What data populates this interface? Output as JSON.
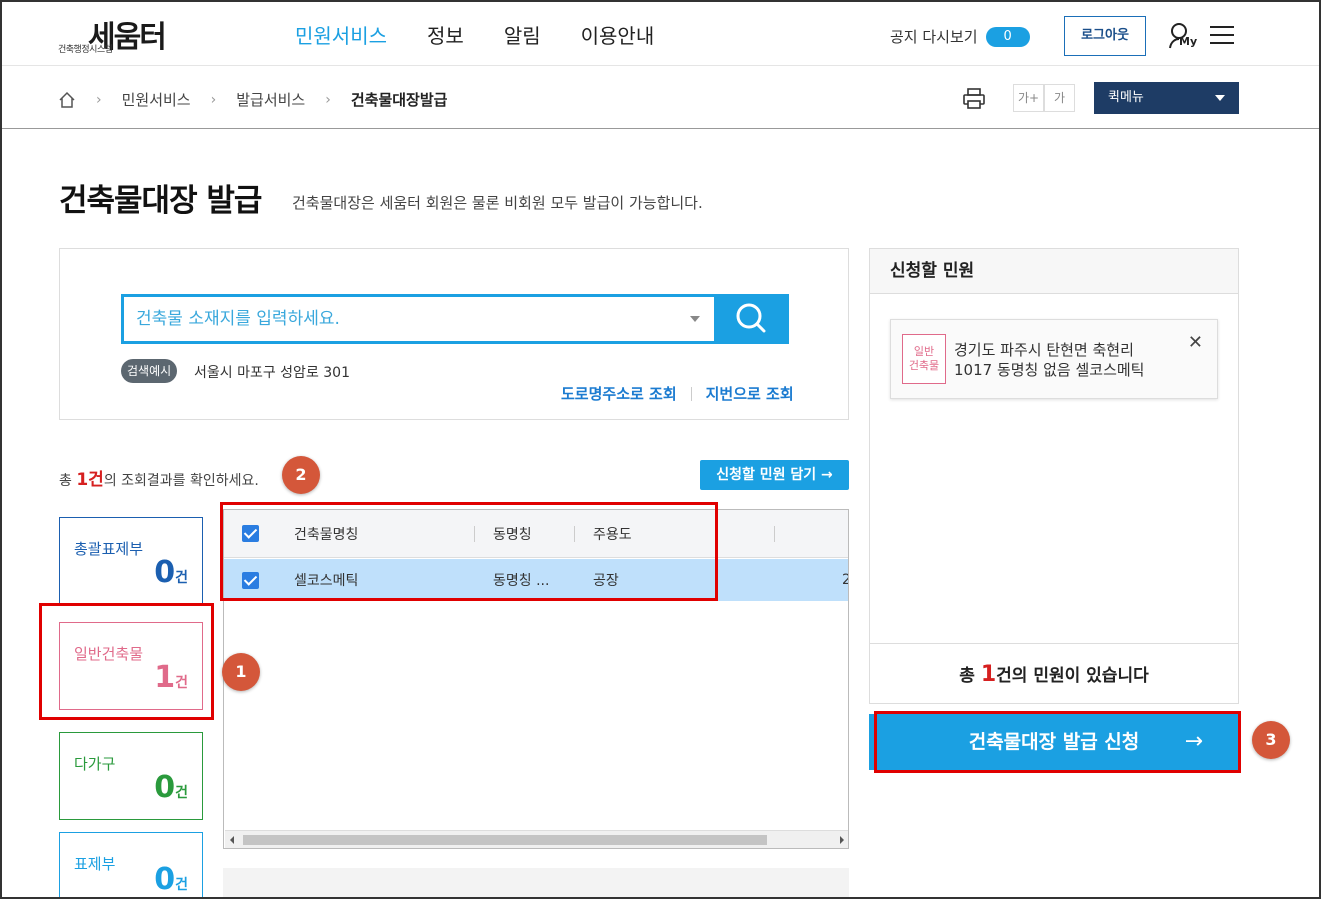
{
  "header": {
    "logo_text": "세움터",
    "logo_sub": "건축행정시스템",
    "nav": [
      "민원서비스",
      "정보",
      "알림",
      "이용안내"
    ],
    "notice_label": "공지 다시보기",
    "notice_count": "0",
    "logout_label": "로그아웃",
    "my_label": "My"
  },
  "breadcrumb": {
    "items": [
      "민원서비스",
      "발급서비스",
      "건축물대장발급"
    ]
  },
  "toolbar": {
    "font_increase": "가+",
    "font_normal": "가",
    "quick_menu": "퀵메뉴"
  },
  "page": {
    "title": "건축물대장 발급",
    "description": "건축물대장은 세움터 회원은 물론 비회원 모두 발급이 가능합니다."
  },
  "search": {
    "placeholder": "건축물 소재지를 입력하세요.",
    "example_badge": "검색예시",
    "example_text": "서울시 마포구 성암로 301",
    "link_road": "도로명주소로 조회",
    "link_lot": "지번으로 조회"
  },
  "results": {
    "prefix": "총 ",
    "count": "1건",
    "suffix": "의 조회결과를 확인하세요.",
    "add_button": "신청할 민원 담기 →"
  },
  "categories": [
    {
      "label": "총괄표제부",
      "count": "0",
      "unit": "건"
    },
    {
      "label": "일반건축물",
      "count": "1",
      "unit": "건"
    },
    {
      "label": "다가구",
      "count": "0",
      "unit": "건"
    },
    {
      "label": "표제부",
      "count": "0",
      "unit": "건"
    }
  ],
  "table": {
    "headers": [
      "건축물명칭",
      "동명칭",
      "주용도"
    ],
    "rows": [
      {
        "name": "셀코스메틱",
        "dong": "동명칭 ...",
        "use": "공장",
        "extra": "2"
      }
    ]
  },
  "cart": {
    "title": "신청할 민원",
    "tag_line1": "일반",
    "tag_line2": "건축물",
    "address_line1": "경기도 파주시 탄현면 축현리",
    "address_line2": "1017 동명칭 없음 셀코스메틱",
    "close": "✕",
    "summary_prefix": "총 ",
    "summary_count": "1",
    "summary_suffix": "건의 민원이 있습니다"
  },
  "apply_button": {
    "label": "건축물대장 발급 신청",
    "arrow": "→"
  },
  "steps": [
    "1",
    "2",
    "3"
  ],
  "colors": {
    "accent": "#1ba0e2",
    "navy": "#1e3c65",
    "highlight": "#e00000",
    "step_badge": "#d4573a",
    "general_building": "#e06a8a"
  }
}
